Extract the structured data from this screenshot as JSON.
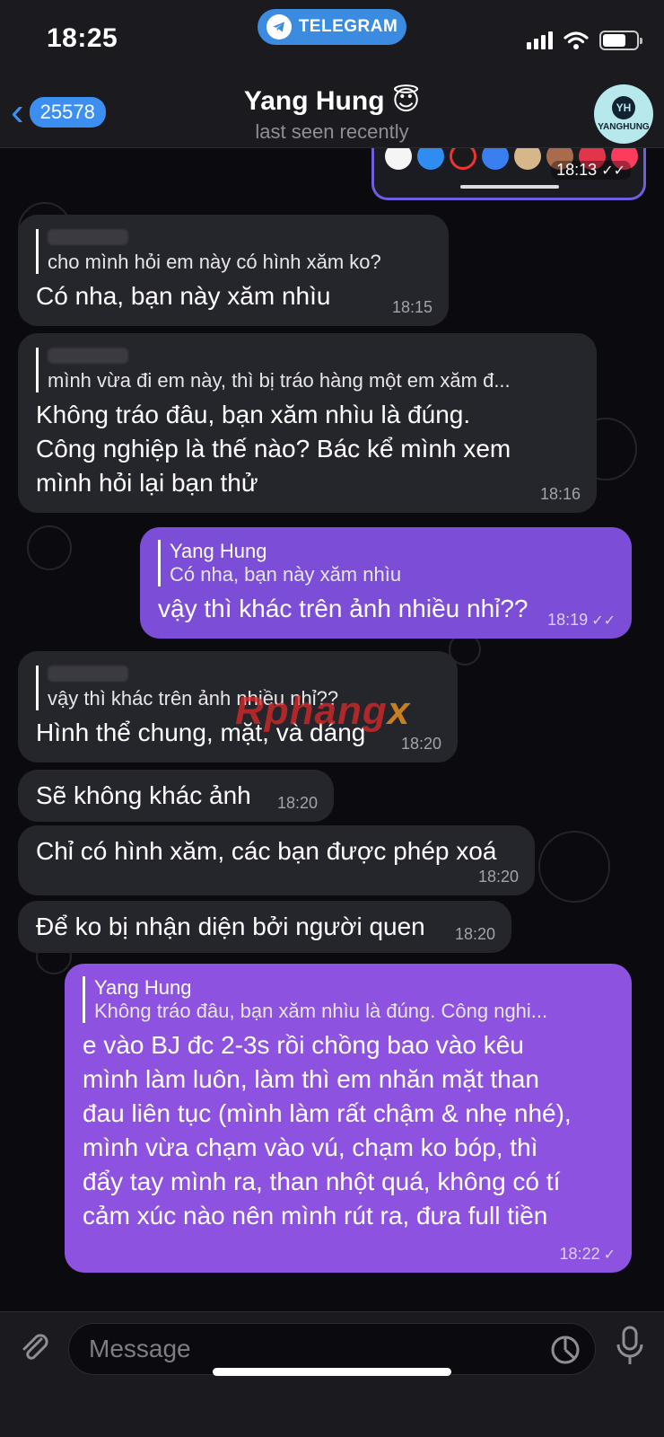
{
  "status_bar": {
    "time": "18:25",
    "app_pill": "TELEGRAM"
  },
  "header": {
    "back_count": "25578",
    "contact_name": "Yang Hung 😇",
    "contact_status": "last seen recently",
    "avatar_text": "YANGHUNG"
  },
  "preview": {
    "time": "18:13"
  },
  "messages": [
    {
      "direction": "in",
      "reply_text": "cho mình hỏi em này có hình xăm ko?",
      "text": "Có nha, bạn này xăm nhìu",
      "time": "18:15"
    },
    {
      "direction": "in",
      "reply_text": "mình vừa đi em này, thì bị tráo hàng một em xăm đ...",
      "text": "Không tráo đâu, bạn xăm nhìu là đúng.\nCông nghiệp là thế nào? Bác kể mình xem\nmình hỏi lại bạn thử",
      "time": "18:16"
    },
    {
      "direction": "out",
      "reply_name": "Yang Hung",
      "reply_text": "Có nha, bạn này xăm nhìu",
      "text": "vậy thì khác trên ảnh nhiều nhỉ??",
      "time": "18:19"
    },
    {
      "direction": "in",
      "reply_text": "vậy thì khác trên ảnh nhiều nhỉ??",
      "text": "Hình thể chung, mặt, và dáng",
      "time": "18:20"
    },
    {
      "direction": "in",
      "text": "Sẽ không khác ảnh",
      "time": "18:20"
    },
    {
      "direction": "in",
      "text": "Chỉ có hình xăm, các bạn được phép xoá",
      "time": "18:20"
    },
    {
      "direction": "in",
      "text": "Để ko bị nhận diện bởi người quen",
      "time": "18:20"
    },
    {
      "direction": "out",
      "reply_name": "Yang Hung",
      "reply_text": "Không tráo đâu, bạn xăm nhìu là đúng. Công nghi...",
      "text": "e vào BJ đc 2-3s rồi chồng bao vào kêu\nmình làm luôn, làm thì em nhăn mặt than\nđau liên tục (mình làm rất chậm & nhẹ nhé),\nmình vừa chạm vào vú, chạm ko bóp, thì\nđẩy tay mình ra, than nhột quá, không có tí\ncảm xúc nào nên mình rút ra, đưa full tiền",
      "time": "18:22"
    }
  ],
  "watermark": {
    "part1": "Rphang",
    "part2": "x"
  },
  "input": {
    "placeholder": "Message"
  },
  "colors": {
    "accent": "#3c8ff0",
    "outgoing_bubble": "#7c4ed8",
    "incoming_bubble": "#25252c"
  }
}
